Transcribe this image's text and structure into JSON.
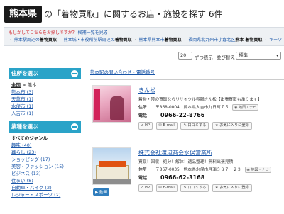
{
  "header": {
    "prefecture": "熊本県",
    "title": "の「着物買取」に関するお店・施設を探す 6件"
  },
  "suggestion": {
    "question": "もしかしてこちらをお探しですか？",
    "list_link": "候補一覧を見る",
    "keywords": [
      {
        "place": "熊本駅周辺の",
        "term": "着物買取"
      },
      {
        "place": "熊本城・市役所前駅周辺の",
        "term": "着物買取"
      },
      {
        "place": "熊本県熊本市",
        "term": "着物買取"
      },
      {
        "place": "福岡県北九州市小倉北区",
        "term": "熊本 着物買取"
      },
      {
        "place": "キーワ",
        "term": ""
      }
    ]
  },
  "toolbar": {
    "per_page_value": "20",
    "per_page_label": "ずつ表示",
    "sort_label": "並び替え：",
    "sort_value": "標準"
  },
  "sidebar": {
    "area": {
      "heading": "住所を選ぶ",
      "current": "全国",
      "current_suffix": " > 熊本",
      "items": [
        "熊本市 (3)",
        "天草市 (1)",
        "水俣市 (1)",
        "人吉市 (1)"
      ]
    },
    "genre": {
      "heading": "業種を選ぶ",
      "all_label": "すべてのジャンル",
      "items": [
        "趣味 (40)",
        "暮らし (23)",
        "ショッピング (17)",
        "美容・ファッション (15)",
        "ビジネス (13)",
        "住まい (8)",
        "自動車・バイク (2)",
        "レジャー・スポーツ (2)"
      ]
    }
  },
  "main": {
    "ref_link": "熊本駅の問い合わせ・電話番号",
    "listings": [
      {
        "name": "きん松",
        "description": "着物・帯の買取ならリサイクル呉服きん松【出張買取も承ります】",
        "address_label": "住所",
        "address": "〒868-0004　熊本県人吉市九日町７５",
        "map_label": "地図・ナビ",
        "tel_label": "電話",
        "tel": "0966-22-8766",
        "badge": "",
        "buttons": [
          "HP",
          "E-mail",
          "口コミする",
          "お気に入りに登録"
        ]
      },
      {
        "name": "株式会社渡辺商会水俣営業所",
        "description": "買取！回収！処分！解体！遺品整理！無料出張見積",
        "address_label": "住所",
        "address": "〒867-0035　熊本県水俣市月浦３８７－２３",
        "map_label": "地図・ナビ",
        "tel_label": "電話",
        "tel": "0966-62-3168",
        "badge": "動画",
        "buttons": [
          "HP",
          "E-mail",
          "口コミする",
          "お気に入りに登録"
        ]
      }
    ]
  }
}
